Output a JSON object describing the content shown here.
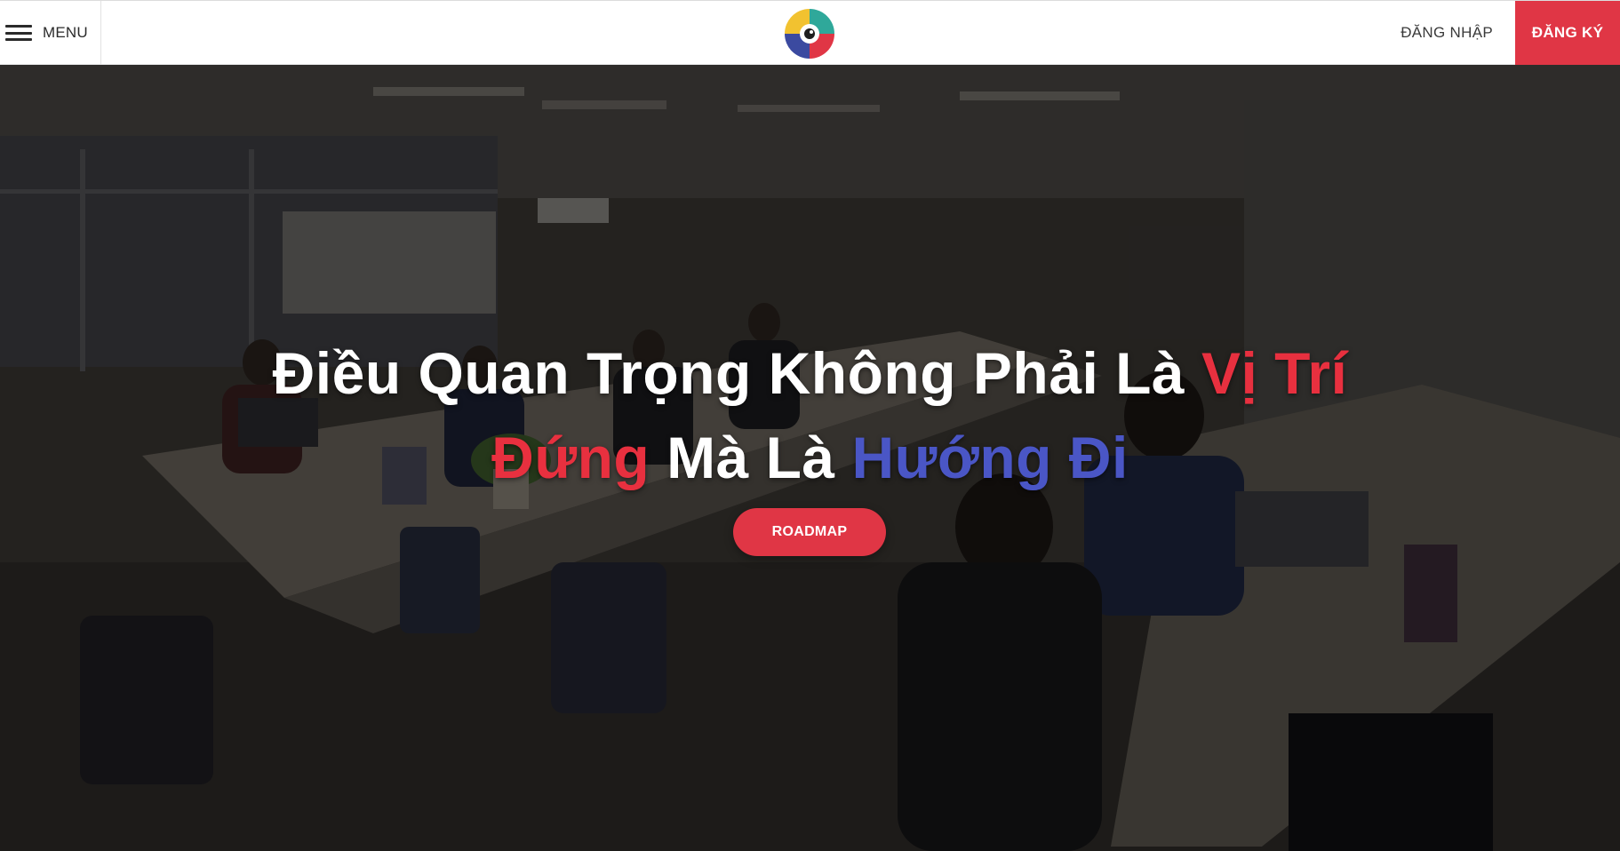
{
  "header": {
    "menu_label": "MENU",
    "login_label": "ĐĂNG NHẬP",
    "register_label": "ĐĂNG KÝ",
    "logo_icon": "brand-logo-icon"
  },
  "hero": {
    "headline": {
      "line1_white": "Điều Quan Trọng Không Phải Là ",
      "line1_red": "Vị Trí",
      "line2_red": "Đứng",
      "line2_white": " Mà Là ",
      "line2_blue": "Hướng Đi"
    },
    "cta_label": "ROADMAP",
    "background": "classroom-photo"
  },
  "colors": {
    "accent_red": "#e03645",
    "accent_blue": "#4a56c6",
    "logo_yellow": "#f2c230",
    "logo_teal": "#2fa89a",
    "logo_navy": "#3b4aa0"
  }
}
